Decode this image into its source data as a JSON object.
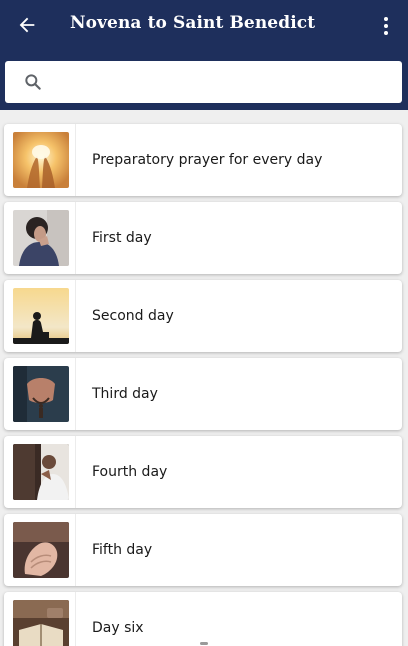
{
  "app_bar": {
    "title": "Novena to Saint Benedict",
    "back_icon": "arrow-left-icon",
    "menu_icon": "more-vertical-icon"
  },
  "search": {
    "value": "",
    "placeholder": "",
    "icon": "search-icon"
  },
  "colors": {
    "app_bar": "#1e2f5c",
    "background": "#efefef",
    "card": "#ffffff"
  },
  "days": [
    {
      "label": "Preparatory prayer for every day",
      "image": "praying-hands-sunlight"
    },
    {
      "label": "First day",
      "image": "woman-praying"
    },
    {
      "label": "Second day",
      "image": "kneeling-silhouette-sunset"
    },
    {
      "label": "Third day",
      "image": "hands-with-rosary"
    },
    {
      "label": "Fourth day",
      "image": "man-praying-by-window"
    },
    {
      "label": "Fifth day",
      "image": "clasped-hands"
    },
    {
      "label": "Day six",
      "image": "open-bible"
    }
  ]
}
